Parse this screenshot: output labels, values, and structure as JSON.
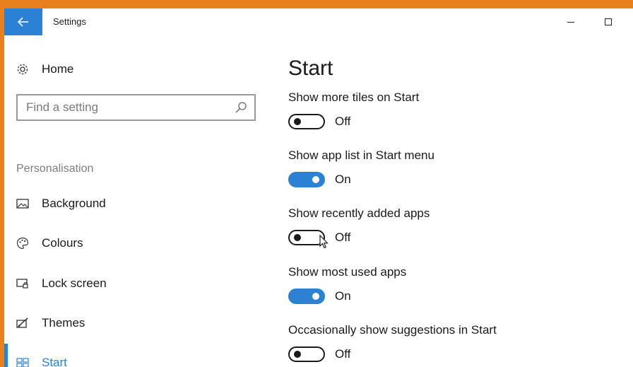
{
  "window": {
    "title": "Settings"
  },
  "colors": {
    "accent": "#2b82d4",
    "frame": "#e8801e"
  },
  "sidebar": {
    "home_label": "Home",
    "search": {
      "placeholder": "Find a setting"
    },
    "section_heading": "Personalisation",
    "items": [
      {
        "label": "Background",
        "icon": "picture-icon"
      },
      {
        "label": "Colours",
        "icon": "palette-icon"
      },
      {
        "label": "Lock screen",
        "icon": "lock-screen-icon"
      },
      {
        "label": "Themes",
        "icon": "themes-icon"
      },
      {
        "label": "Start",
        "icon": "start-tiles-icon",
        "active": true
      }
    ]
  },
  "main": {
    "title": "Start",
    "settings": [
      {
        "label": "Show more tiles on Start",
        "state": "Off",
        "on": false
      },
      {
        "label": "Show app list in Start menu",
        "state": "On",
        "on": true
      },
      {
        "label": "Show recently added apps",
        "state": "Off",
        "on": false
      },
      {
        "label": "Show most used apps",
        "state": "On",
        "on": true
      },
      {
        "label": "Occasionally show suggestions in Start",
        "state": "Off",
        "on": false
      }
    ]
  }
}
